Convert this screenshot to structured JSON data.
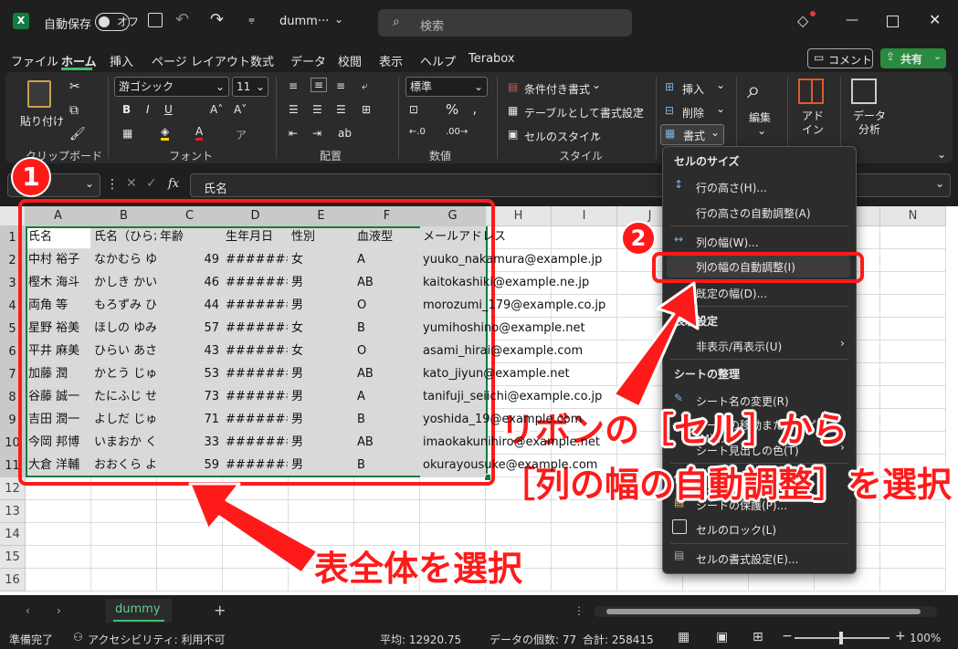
{
  "titlebar": {
    "autosave_label": "自動保存",
    "autosave_state": "オフ",
    "filename": "dumm···",
    "search_placeholder": "検索"
  },
  "menu": {
    "tabs": [
      "ファイル",
      "ホーム",
      "挿入",
      "ページ レイアウト",
      "数式",
      "データ",
      "校閲",
      "表示",
      "ヘルプ",
      "Terabox"
    ],
    "active": "ホーム",
    "comment_label": "コメント",
    "share_label": "共有"
  },
  "ribbon": {
    "paste_label": "貼り付け",
    "clipboard_label": "クリップボード",
    "font_name": "游ゴシック",
    "font_size": "11",
    "font_label": "フォント",
    "align_label": "配置",
    "number_format": "標準",
    "number_label": "数値",
    "conditional_format": "条件付き書式",
    "table_format": "テーブルとして書式設定",
    "cell_styles": "セルのスタイル",
    "styles_label": "スタイル",
    "insert_label": "挿入",
    "delete_label": "削除",
    "format_label": "書式",
    "edit_label": "編集",
    "addin_label": "アド\nイン",
    "analyze_label": "データ\n分析"
  },
  "formula_bar": {
    "fx": "fx",
    "content": "氏名"
  },
  "sheet": {
    "columns": [
      "A",
      "B",
      "C",
      "D",
      "E",
      "F",
      "G",
      "H",
      "I",
      "J",
      "K",
      "L",
      "M",
      "N"
    ],
    "row_numbers": [
      "1",
      "2",
      "3",
      "4",
      "5",
      "6",
      "7",
      "8",
      "9",
      "10",
      "11",
      "12",
      "13",
      "14",
      "15",
      "16"
    ],
    "rows": [
      [
        "氏名",
        "氏名（ひらがな）",
        "年齢",
        "生年月日",
        "性別",
        "血液型",
        "メールアドレス"
      ],
      [
        "中村 裕子",
        "なかむら ゆうこ",
        "49",
        "#######",
        "女",
        "A",
        "yuuko_nakamura@example.jp"
      ],
      [
        "樫木 海斗",
        "かしき かいと",
        "46",
        "#######",
        "男",
        "AB",
        "kaitokashiki@example.ne.jp"
      ],
      [
        "両角 等",
        "もろずみ ひとし",
        "44",
        "#######",
        "男",
        "O",
        "morozumi_179@example.co.jp"
      ],
      [
        "星野 裕美",
        "ほしの ゆみ",
        "57",
        "#######",
        "女",
        "B",
        "yumihoshino@example.net"
      ],
      [
        "平井 麻美",
        "ひらい あさみ",
        "43",
        "#######",
        "女",
        "O",
        "asami_hirai@example.com"
      ],
      [
        "加藤 潤",
        "かとう じゅん",
        "53",
        "#######",
        "男",
        "AB",
        "kato_jiyun@example.net"
      ],
      [
        "谷藤 誠一",
        "たにふじ せいいち",
        "73",
        "#######",
        "男",
        "A",
        "tanifuji_seiichi@example.co.jp"
      ],
      [
        "吉田 潤一",
        "よしだ じゅんいち",
        "71",
        "#######",
        "男",
        "B",
        "yoshida_19@example.com"
      ],
      [
        "今岡 邦博",
        "いまおか くにひろ",
        "33",
        "#######",
        "男",
        "AB",
        "imaokakunihiro@example.net"
      ],
      [
        "大倉 洋輔",
        "おおくら ようすけ",
        "59",
        "#######",
        "男",
        "B",
        "okurayousuke@example.com"
      ]
    ]
  },
  "context_menu": {
    "cell_size_header": "セルのサイズ",
    "row_height": "行の高さ(H)...",
    "row_autofit": "行の高さの自動調整(A)",
    "col_width": "列の幅(W)...",
    "col_autofit": "列の幅の自動調整(I)",
    "default_width": "既定の幅(D)...",
    "visibility_header": "表示設定",
    "hide_show": "非表示/再表示(U)",
    "organize_header": "シートの整理",
    "rename_sheet": "シート名の変更(R)",
    "move_copy": "シートの移動またはコピー(M)...",
    "tab_color": "シート見出しの色(T)",
    "protect_header": "保護",
    "protect_sheet": "シートの保護(P)...",
    "lock_cell": "セルのロック(L)",
    "format_cells": "セルの書式設定(E)..."
  },
  "tabs": {
    "sheet_name": "dummy"
  },
  "status": {
    "ready": "準備完了",
    "accessibility": "アクセシビリティ: 利用不可",
    "average": "平均: 12920.75",
    "count": "データの個数: 77",
    "sum": "合計: 258415",
    "zoom": "100%"
  },
  "annotations": {
    "step1": "1",
    "step2": "2",
    "select_table": "表全体を選択",
    "from_ribbon": "リボンの［セル］から",
    "select_autofit": "［列の幅の自動調整］を選択"
  },
  "colors": {
    "accent_red": "#ff1a1a",
    "excel_green": "#107c41",
    "share_green": "#2a8a3e"
  }
}
